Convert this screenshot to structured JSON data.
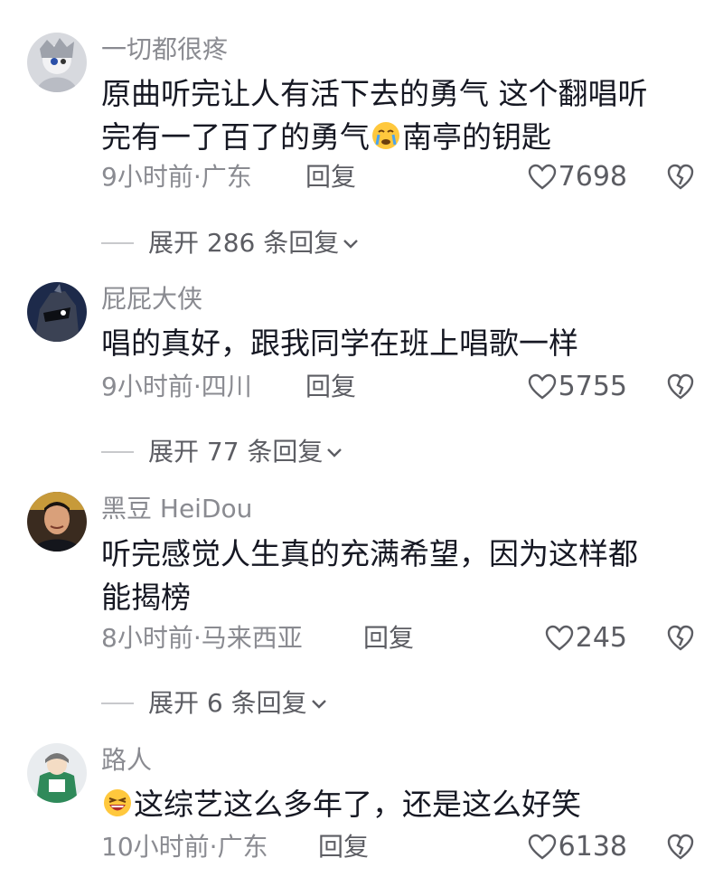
{
  "comments": [
    {
      "username": "一切都很疼",
      "text_line1": "原曲听完让人有活下去的勇气  这个翻唱听",
      "text_line2_a": "完有一了百了的勇气",
      "text_line2_emoji": "crying-face-emoji",
      "text_line2_b": "南亭的钥匙",
      "meta": "9小时前·广东",
      "reply_label": "回复",
      "likes": "7698",
      "expand_label": "展开 286 条回复"
    },
    {
      "username": "屁屁大侠",
      "text_line1": "唱的真好，跟我同学在班上唱歌一样",
      "meta": "9小时前·四川",
      "reply_label": "回复",
      "likes": "5755",
      "expand_label": "展开 77 条回复"
    },
    {
      "username": "黑豆 HeiDou",
      "text_line1": "听完感觉人生真的充满希望，因为这样都",
      "text_line2": "能揭榜",
      "meta": "8小时前·马来西亚",
      "reply_label": "回复",
      "likes": "245",
      "expand_label": "展开 6 条回复"
    },
    {
      "username": "路人",
      "text_emoji": "laughing-face-emoji",
      "text_line1": "这综艺这么多年了，还是这么好笑",
      "meta": "10小时前·广东",
      "reply_label": "回复",
      "likes": "6138"
    }
  ],
  "colors": {
    "text": "#161823",
    "secondary": "#8a8b91",
    "action": "#5c5d63"
  },
  "icons": {
    "like": "heart-outline-icon",
    "dislike": "broken-heart-icon",
    "expand": "chevron-down-icon"
  }
}
